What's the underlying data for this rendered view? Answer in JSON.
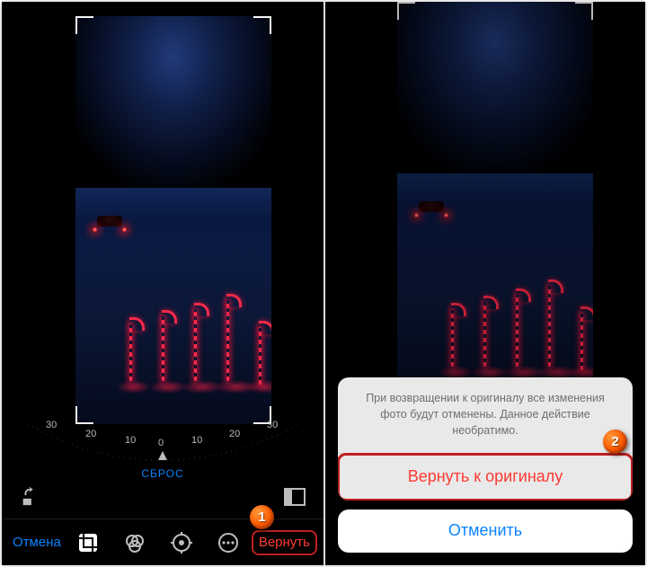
{
  "left": {
    "dial": {
      "labels": [
        "30",
        "20",
        "10",
        "0",
        "10",
        "20",
        "30"
      ]
    },
    "reset_label": "СБРОС",
    "toolbar": {
      "cancel_label": "Отмена",
      "done_label": "Вернуть"
    },
    "icons": {
      "rotate": "rotate-icon",
      "aspect": "aspect-icon",
      "crop": "crop-icon",
      "filters": "filters-icon",
      "adjust": "adjust-icon",
      "more": "more-icon"
    },
    "callout": "1"
  },
  "right": {
    "sheet": {
      "message": "При возвращении к оригиналу все изменения фото будут отменены. Данное действие необратимо.",
      "revert_label": "Вернуть к оригиналу",
      "cancel_label": "Отменить"
    },
    "callout": "2"
  },
  "colors": {
    "accent_blue": "#0a84ff",
    "accent_red": "#ff3b30",
    "highlight_border": "#c02020",
    "callout": "#ff5a00"
  }
}
